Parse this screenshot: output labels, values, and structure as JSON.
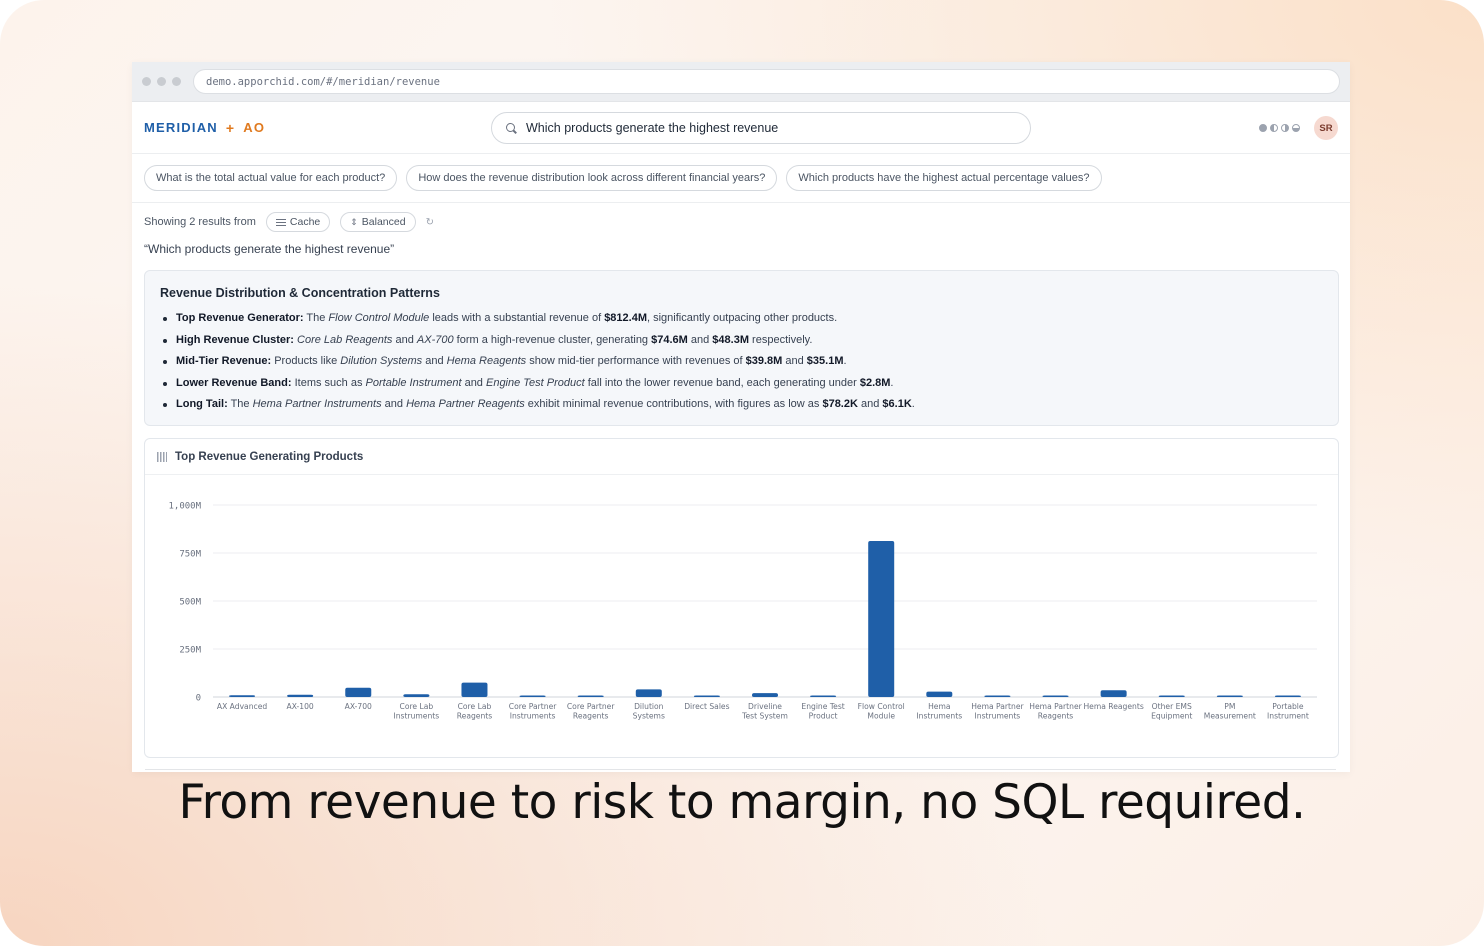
{
  "browser": {
    "url": "demo.apporchid.com/#/meridian/revenue"
  },
  "header": {
    "brand_main": "MERIDIAN",
    "brand_plus": "+",
    "brand_sub": "AO",
    "search_value": "Which products generate the highest revenue",
    "search_icon": "search-icon",
    "avatar_initials": "SR"
  },
  "suggestions": [
    "What is the total actual value for each product?",
    "How does the revenue distribution look across different financial years?",
    "Which products have the highest actual percentage values?"
  ],
  "results": {
    "showing_text": "Showing 2 results from",
    "cache_label": "Cache",
    "balanced_label": "Balanced",
    "query_echo": "“Which products generate the highest revenue”"
  },
  "insights": {
    "title": "Revenue Distribution & Concentration Patterns",
    "items": [
      [
        {
          "t": "b",
          "v": "Top Revenue Generator:"
        },
        {
          "t": "n",
          "v": " The "
        },
        {
          "t": "i",
          "v": "Flow Control Module"
        },
        {
          "t": "n",
          "v": " leads with a substantial revenue of "
        },
        {
          "t": "b",
          "v": "$812.4M"
        },
        {
          "t": "n",
          "v": ", significantly outpacing other products."
        }
      ],
      [
        {
          "t": "b",
          "v": "High Revenue Cluster:"
        },
        {
          "t": "n",
          "v": " "
        },
        {
          "t": "i",
          "v": "Core Lab Reagents"
        },
        {
          "t": "n",
          "v": " and "
        },
        {
          "t": "i",
          "v": "AX-700"
        },
        {
          "t": "n",
          "v": " form a high-revenue cluster, generating "
        },
        {
          "t": "b",
          "v": "$74.6M"
        },
        {
          "t": "n",
          "v": " and "
        },
        {
          "t": "b",
          "v": "$48.3M"
        },
        {
          "t": "n",
          "v": " respectively."
        }
      ],
      [
        {
          "t": "b",
          "v": "Mid-Tier Revenue:"
        },
        {
          "t": "n",
          "v": " Products like "
        },
        {
          "t": "i",
          "v": "Dilution Systems"
        },
        {
          "t": "n",
          "v": " and "
        },
        {
          "t": "i",
          "v": "Hema Reagents"
        },
        {
          "t": "n",
          "v": " show mid-tier performance with revenues of "
        },
        {
          "t": "b",
          "v": "$39.8M"
        },
        {
          "t": "n",
          "v": " and "
        },
        {
          "t": "b",
          "v": "$35.1M"
        },
        {
          "t": "n",
          "v": "."
        }
      ],
      [
        {
          "t": "b",
          "v": "Lower Revenue Band:"
        },
        {
          "t": "n",
          "v": " Items such as "
        },
        {
          "t": "i",
          "v": "Portable Instrument"
        },
        {
          "t": "n",
          "v": " and "
        },
        {
          "t": "i",
          "v": "Engine Test Product"
        },
        {
          "t": "n",
          "v": " fall into the lower revenue band, each generating under "
        },
        {
          "t": "b",
          "v": "$2.8M"
        },
        {
          "t": "n",
          "v": "."
        }
      ],
      [
        {
          "t": "b",
          "v": "Long Tail:"
        },
        {
          "t": "n",
          "v": " The "
        },
        {
          "t": "i",
          "v": "Hema Partner Instruments"
        },
        {
          "t": "n",
          "v": " and "
        },
        {
          "t": "i",
          "v": "Hema Partner Reagents"
        },
        {
          "t": "n",
          "v": " exhibit minimal revenue contributions, with figures as low as "
        },
        {
          "t": "b",
          "v": "$78.2K"
        },
        {
          "t": "n",
          "v": " and "
        },
        {
          "t": "b",
          "v": "$6.1K"
        },
        {
          "t": "n",
          "v": "."
        }
      ]
    ]
  },
  "chart_title": "Top Revenue Generating Products",
  "chart_data": {
    "type": "bar",
    "categories": [
      [
        "AX Advanced"
      ],
      [
        "AX-100"
      ],
      [
        "AX-700"
      ],
      [
        "Core Lab",
        "Instruments"
      ],
      [
        "Core Lab",
        "Reagents"
      ],
      [
        "Core Partner",
        "Instruments"
      ],
      [
        "Core Partner",
        "Reagents"
      ],
      [
        "Dilution",
        "Systems"
      ],
      [
        "Direct Sales"
      ],
      [
        "Driveline",
        "Test System"
      ],
      [
        "Engine Test",
        "Product"
      ],
      [
        "Flow Control",
        "Module"
      ],
      [
        "Hema",
        "Instruments"
      ],
      [
        "Hema Partner",
        "Instruments"
      ],
      [
        "Hema Partner",
        "Reagents"
      ],
      [
        "Hema Reagents"
      ],
      [
        "Other EMS",
        "Equipment"
      ],
      [
        "PM",
        "Measurement"
      ],
      [
        "Portable",
        "Instrument"
      ]
    ],
    "values": [
      9,
      12,
      48.3,
      14,
      74.6,
      6,
      4,
      39.8,
      3,
      20,
      2.8,
      812.4,
      28,
      0.0782,
      0.0061,
      35.1,
      5,
      3.5,
      2.5
    ],
    "ylim": [
      0,
      1000
    ],
    "yticks": [
      0,
      250,
      500,
      750,
      1000
    ],
    "ytick_labels": [
      "0",
      "250M",
      "500M",
      "750M",
      "1,000M"
    ],
    "grid": true,
    "bar_color": "#1f5fa8"
  },
  "tagline": "From revenue to risk to margin, no SQL required."
}
